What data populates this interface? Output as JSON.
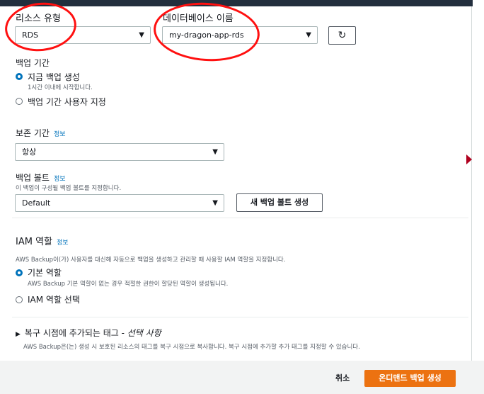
{
  "resource_type": {
    "label": "리소스 유형",
    "value": "RDS"
  },
  "database_name": {
    "label": "데이터베이스 이름",
    "value": "my-dragon-app-rds"
  },
  "backup_window": {
    "label": "백업 기간",
    "options": [
      {
        "label": "지금 백업 생성",
        "hint": "1시간 이내에 시작합니다.",
        "selected": true
      },
      {
        "label": "백업 기간 사용자 지정",
        "selected": false
      }
    ]
  },
  "retention": {
    "label": "보존 기간",
    "info": "정보",
    "value": "항상"
  },
  "vault": {
    "label": "백업 볼트",
    "info": "정보",
    "hint": "이 백업이 구성될 백업 볼트를 지정합니다.",
    "value": "Default",
    "create_button": "새 백업 볼트 생성"
  },
  "iam": {
    "label": "IAM 역할",
    "info": "정보",
    "hint": "AWS Backup이(가) 사용자를 대신해 자동으로 백업을 생성하고 관리할 때 사용할 IAM 역할을 지정합니다.",
    "options": [
      {
        "label": "기본 역할",
        "hint": "AWS Backup 기본 역할이 없는 경우 적절한 권한이 할당된 역할이 생성됩니다.",
        "selected": true
      },
      {
        "label": "IAM 역할 선택",
        "selected": false
      }
    ]
  },
  "tags": {
    "label": "복구 시점에 추가되는 태그 - ",
    "optional": "선택 사항",
    "hint": "AWS Backup은(는) 생성 시 보호된 리소스의 태그를 복구 시점으로 복사합니다. 복구 시점에 추가할 추가 태그를 지정할 수 있습니다."
  },
  "footer": {
    "cancel": "취소",
    "submit": "온디맨드 백업 생성"
  },
  "colors": {
    "primary": "#ec7211",
    "link": "#0073bb",
    "annotation": "#ff1010"
  }
}
